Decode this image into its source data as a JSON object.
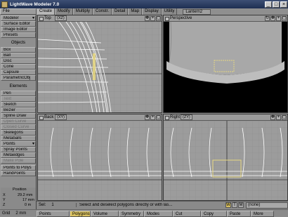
{
  "window": {
    "title": "LightWave Modeler 7.0"
  },
  "menubar": {
    "file_label": "File",
    "tabs": [
      {
        "label": "Create",
        "active": true
      },
      {
        "label": "Modify",
        "active": false
      },
      {
        "label": "Multiply",
        "active": false
      },
      {
        "label": "Constr.",
        "active": false
      },
      {
        "label": "Detail",
        "active": false
      },
      {
        "label": "Map",
        "active": false
      },
      {
        "label": "Display",
        "active": false
      },
      {
        "label": "Utility",
        "active": false
      }
    ],
    "object_menu": "Lantern2"
  },
  "sidebar": {
    "modeler": "Modeler",
    "surface_editor": "Surface Editor",
    "image_editor": "Image Editor",
    "presets": "Presets",
    "objects_header": "Objects",
    "box": "Box",
    "ball": "Ball",
    "disc": "Disc",
    "cone": "Cone",
    "capsule": "Capsule",
    "parametricobj": "ParametricObj",
    "elements_header": "Elements",
    "pen": "Pen",
    "text": "Text",
    "sketch": "Sketch",
    "bezier": "Bezier",
    "spline_draw": "Spline Draw",
    "open_curve": "Open Curve",
    "closed_curve": "Closed Curve",
    "skelegons": "Skelegons",
    "metaballs": "Metaballs",
    "points": "Points",
    "spray_points": "Spray Points",
    "metaedges": "Metaedges",
    "make_pole": "Make Pole",
    "points_to_polys": "Points to Polys",
    "randpoints": "RandPoints",
    "position": {
      "title": "Position",
      "x_label": "X",
      "x_value": "29.2 mm",
      "y_label": "Y",
      "y_value": "17 mm",
      "z_label": "Z",
      "z_value": "0 m"
    }
  },
  "viewports": {
    "top": {
      "label": "Top",
      "mode": "(XZ)"
    },
    "perspective": {
      "label": "Perspective"
    },
    "back": {
      "label": "Back",
      "mode": "(XY)"
    },
    "right": {
      "label": "Right",
      "mode": "(ZY)"
    }
  },
  "status": {
    "sel_label": "Sel:",
    "sel_value": "1",
    "message": "Select and deselect polygons directly or with las...",
    "buttons": [
      "W",
      "T",
      "M"
    ],
    "layer": "(none)"
  },
  "bottombar": {
    "grid_label": "Grid",
    "grid_value": "2 mm",
    "points": "Points",
    "polygons": "Polygons",
    "volume": "Volume",
    "symmetry": "Symmetry",
    "modes": "Modes",
    "cut": "Cut",
    "copy": "Copy",
    "paste": "Paste",
    "more": "More"
  },
  "colors": {
    "selection": "#e8d880",
    "wire": "#ffffff",
    "grid": "#8d8d8d",
    "title_bar": "#2b3d63"
  }
}
